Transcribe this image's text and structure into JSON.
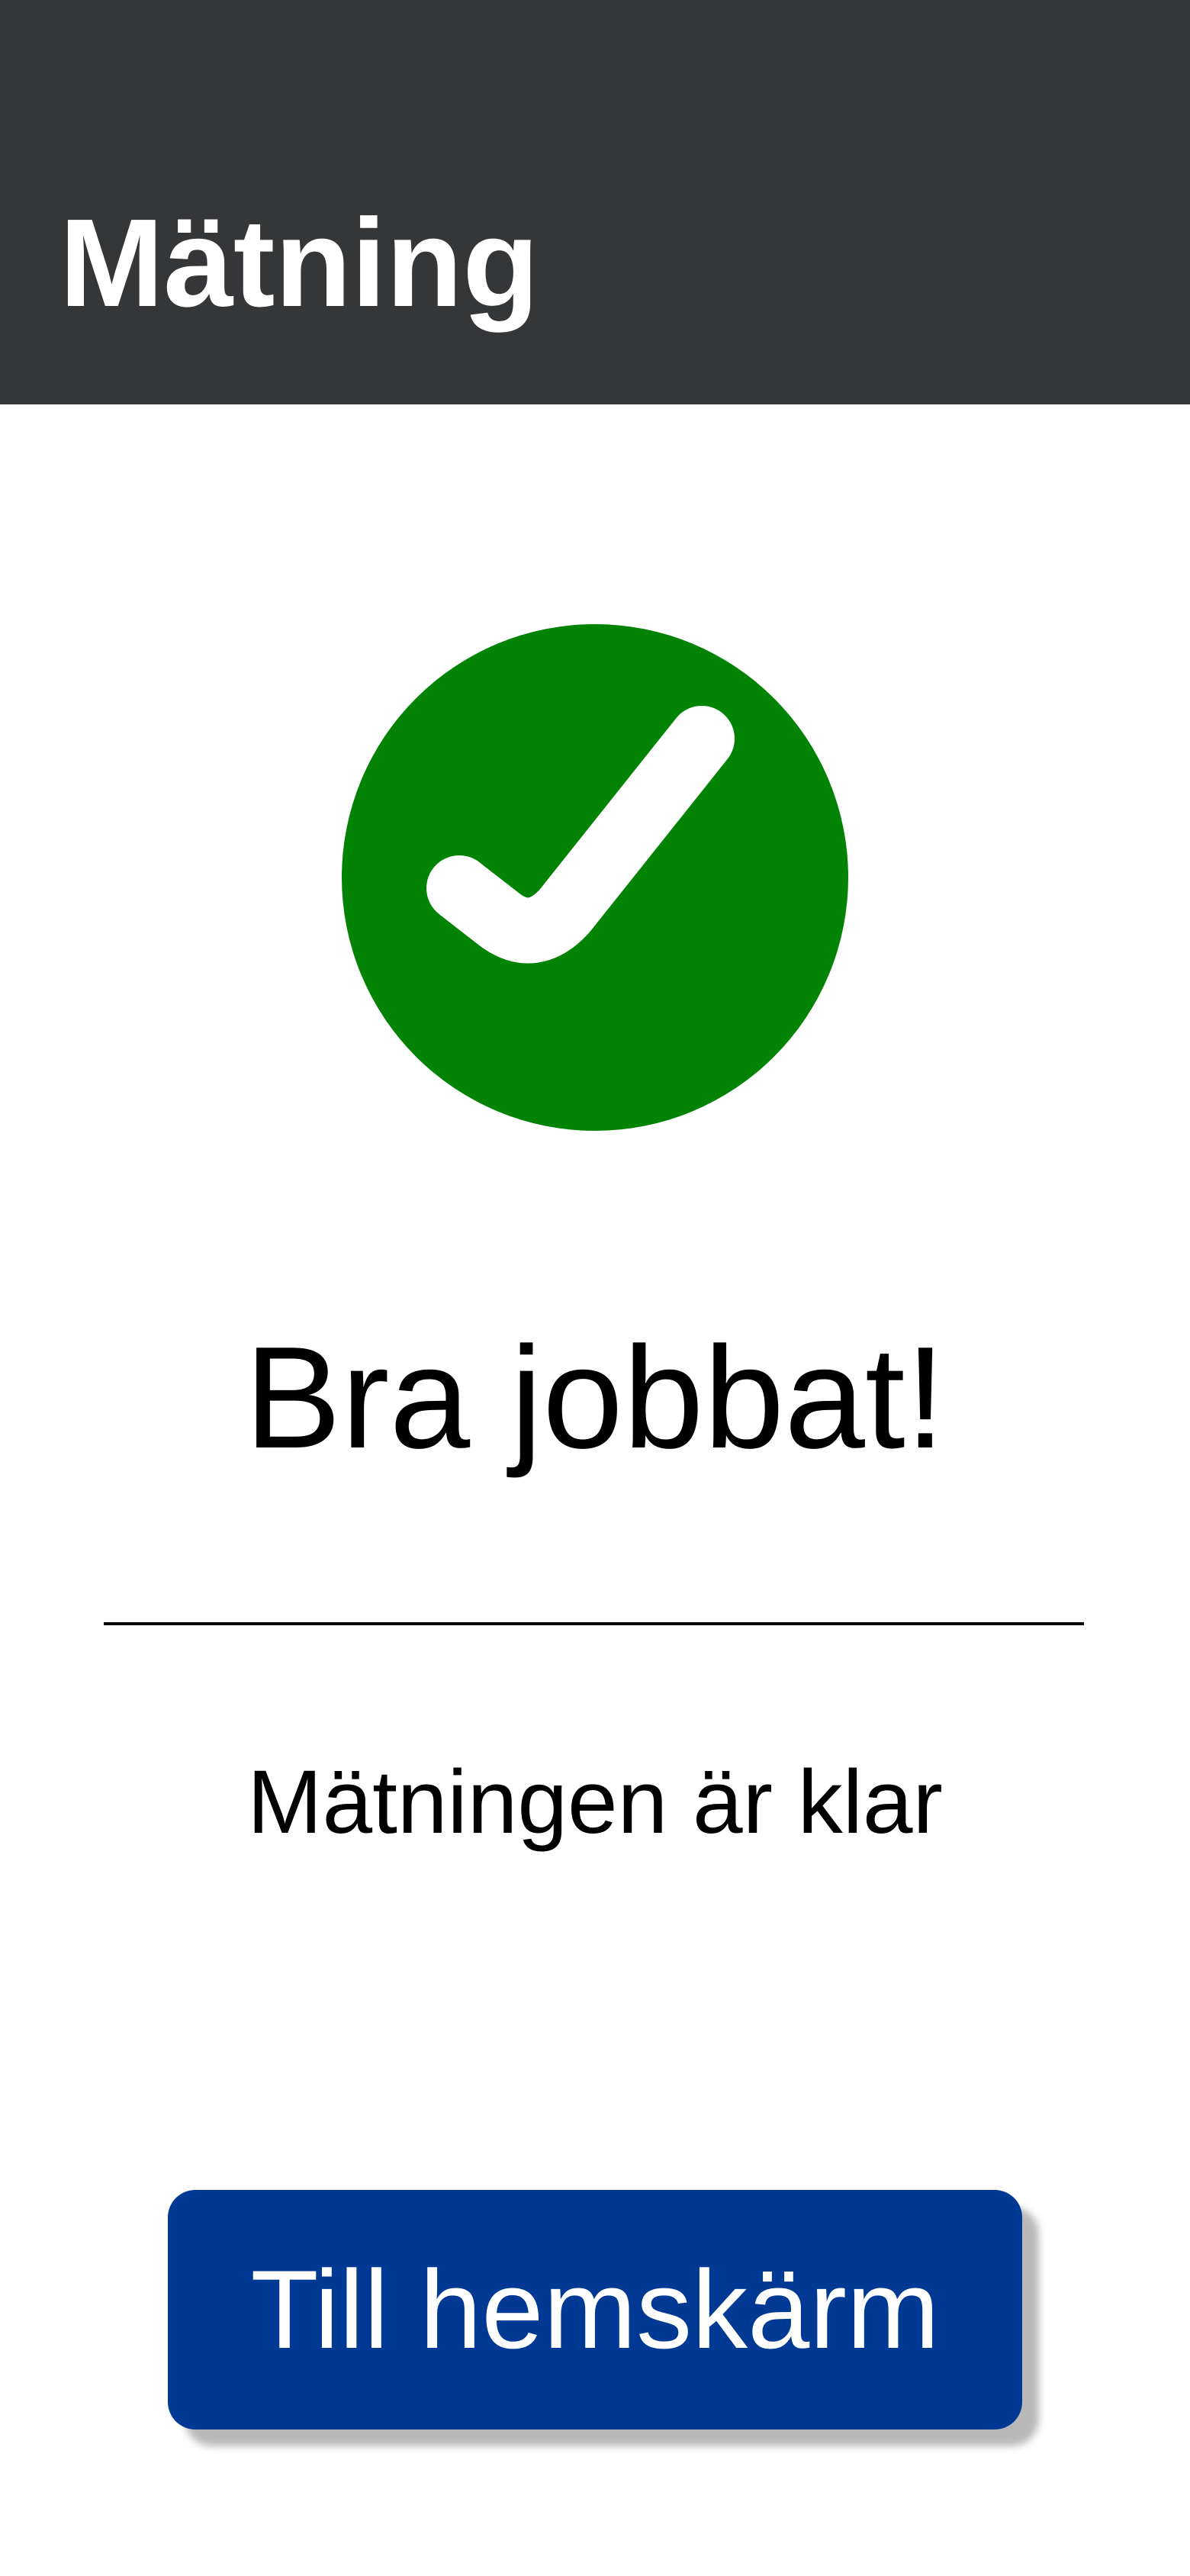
{
  "header": {
    "title": "Mätning"
  },
  "status": {
    "icon": "check-circle-icon",
    "icon_color": "#028303",
    "headline": "Bra jobbat!",
    "message": "Mätningen är klar"
  },
  "actions": {
    "home_button_label": "Till hemskärm",
    "home_button_color": "#003994"
  },
  "colors": {
    "header_background": "#353638",
    "page_background": "#ffffff"
  }
}
